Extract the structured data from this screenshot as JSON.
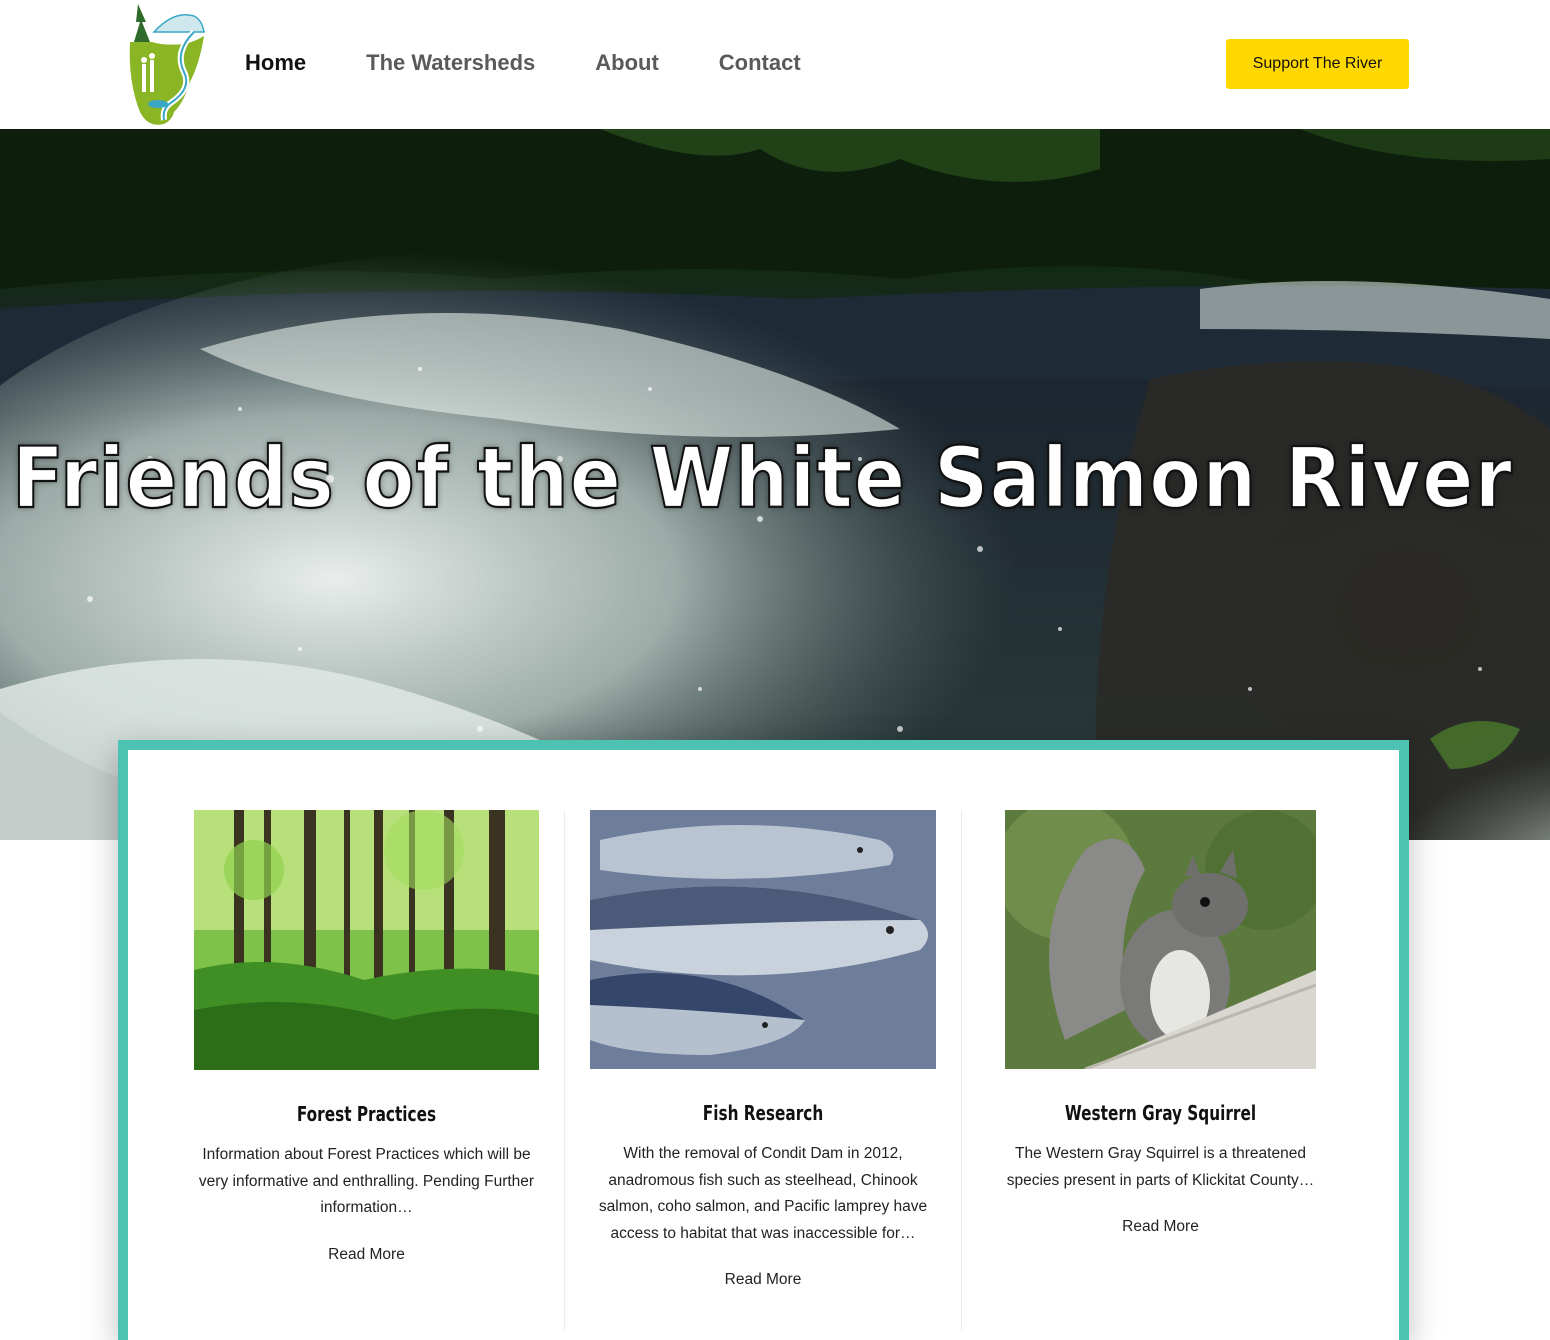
{
  "header": {
    "logo_icon": "river-forest-logo-icon",
    "nav": [
      {
        "label": "Home",
        "active": true
      },
      {
        "label": "The Watersheds",
        "active": false
      },
      {
        "label": "About",
        "active": false
      },
      {
        "label": "Contact",
        "active": false
      }
    ],
    "support_label": "Support The River"
  },
  "hero": {
    "title": "Friends of the White Salmon River",
    "image": "waterfall-rapids-image"
  },
  "cards": [
    {
      "image": "forest-image",
      "title": "Forest Practices",
      "text": "Information about Forest Practices which will be very informative and enthralling. Pending Further information…",
      "link": "Read More"
    },
    {
      "image": "salmon-fish-image",
      "title": "Fish Research",
      "text": "With the removal of Condit Dam in 2012, anadromous fish such as steelhead, Chinook salmon, coho salmon, and Pacific lamprey have access to habitat that was inaccessible for…",
      "link": "Read More"
    },
    {
      "image": "gray-squirrel-image",
      "title": "Western Gray Squirrel",
      "text": "The Western Gray Squirrel is a threatened species present in parts of Klickitat County…",
      "link": "Read More"
    }
  ],
  "colors": {
    "accent_teal": "#4cc2b2",
    "button_yellow": "#ffd800",
    "logo_green": "#7aa51c"
  }
}
